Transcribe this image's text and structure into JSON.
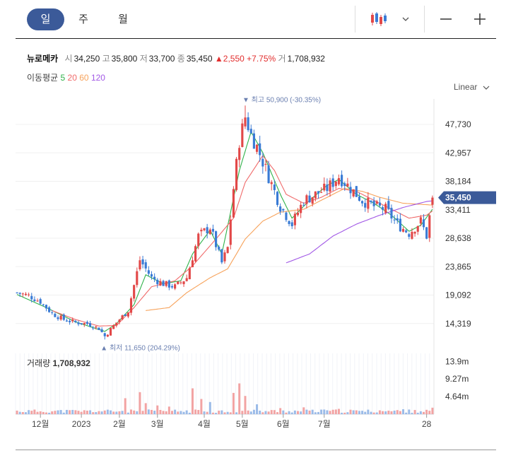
{
  "period_tabs": [
    {
      "label": "일",
      "active": true
    },
    {
      "label": "주",
      "active": false
    },
    {
      "label": "월",
      "active": false
    }
  ],
  "toolbar": {
    "chart_type_icon": "candlestick-icon",
    "dropdown_icon": "chevron-down-icon",
    "zoom_out_icon": "minus-icon",
    "zoom_in_icon": "plus-icon"
  },
  "quote": {
    "name": "뉴로메카",
    "open_label": "시",
    "open": "34,250",
    "high_label": "고",
    "high": "35,800",
    "low_label": "저",
    "low": "33,700",
    "close_label": "종",
    "close": "35,450",
    "change_arrow": "▲",
    "change": "2,550",
    "change_pct": "+7.75%",
    "volume_label": "거",
    "volume": "1,708,932"
  },
  "moving_average": {
    "label": "이동평균",
    "items": [
      {
        "period": "5",
        "color": "#2fb24a"
      },
      {
        "period": "20",
        "color": "#f06a6a"
      },
      {
        "period": "60",
        "color": "#f7a35c"
      },
      {
        "period": "120",
        "color": "#a259e6"
      }
    ]
  },
  "scale_selector": "Linear",
  "colors": {
    "up": "#e24848",
    "down": "#3a7bd5",
    "accent": "#3b5a99"
  },
  "chart_data": {
    "type": "candlestick",
    "price_axis_ticks": [
      "47,730",
      "42,957",
      "38,184",
      "33,411",
      "28,638",
      "23,865",
      "19,092",
      "14,319"
    ],
    "price_axis_values": [
      47730,
      42957,
      38184,
      33411,
      28638,
      23865,
      19092,
      14319
    ],
    "current_price_label": "35,450",
    "current_price": 35450,
    "high_annotation": {
      "marker": "▼",
      "label": "최고",
      "value": "50,900",
      "pct": "(-30.35%)"
    },
    "low_annotation": {
      "marker": "▲",
      "label": "최저",
      "value": "11,650",
      "pct": "(204.29%)"
    },
    "x_axis_labels": [
      "12월",
      "2023",
      "2월",
      "3월",
      "4월",
      "5월",
      "6월",
      "7월",
      "28"
    ],
    "close_path": [
      [
        0,
        19500
      ],
      [
        4,
        19000
      ],
      [
        8,
        18000
      ],
      [
        12,
        16000
      ],
      [
        16,
        15000
      ],
      [
        20,
        14500
      ],
      [
        24,
        14300
      ],
      [
        28,
        13500
      ],
      [
        30,
        12200
      ],
      [
        34,
        14500
      ],
      [
        38,
        16500
      ],
      [
        42,
        25000
      ],
      [
        46,
        22000
      ],
      [
        50,
        21000
      ],
      [
        54,
        20500
      ],
      [
        58,
        22000
      ],
      [
        62,
        29000
      ],
      [
        66,
        30500
      ],
      [
        70,
        24500
      ],
      [
        72,
        27000
      ],
      [
        74,
        37000
      ],
      [
        76,
        45000
      ],
      [
        78,
        49000
      ],
      [
        80,
        46000
      ],
      [
        82,
        44000
      ],
      [
        86,
        39000
      ],
      [
        90,
        34000
      ],
      [
        94,
        31000
      ],
      [
        98,
        35000
      ],
      [
        102,
        36000
      ],
      [
        106,
        37000
      ],
      [
        110,
        39000
      ],
      [
        114,
        37000
      ],
      [
        118,
        35000
      ],
      [
        122,
        34000
      ],
      [
        126,
        33500
      ],
      [
        130,
        31000
      ],
      [
        134,
        29500
      ],
      [
        138,
        31500
      ],
      [
        140,
        29000
      ],
      [
        142,
        35450
      ]
    ],
    "ma_series": [
      {
        "name": "5",
        "points": [
          [
            0,
            19200
          ],
          [
            10,
            17000
          ],
          [
            20,
            14600
          ],
          [
            30,
            13000
          ],
          [
            34,
            14300
          ],
          [
            40,
            17500
          ],
          [
            44,
            22500
          ],
          [
            50,
            21000
          ],
          [
            56,
            21500
          ],
          [
            60,
            26000
          ],
          [
            66,
            30000
          ],
          [
            70,
            26000
          ],
          [
            76,
            40000
          ],
          [
            80,
            46500
          ],
          [
            84,
            43000
          ],
          [
            90,
            36000
          ],
          [
            94,
            32000
          ],
          [
            100,
            35000
          ],
          [
            106,
            37500
          ],
          [
            110,
            38500
          ],
          [
            116,
            36000
          ],
          [
            122,
            34500
          ],
          [
            128,
            32500
          ],
          [
            134,
            29800
          ],
          [
            138,
            30800
          ],
          [
            142,
            33500
          ]
        ]
      },
      {
        "name": "20",
        "points": [
          [
            12,
            16500
          ],
          [
            20,
            15000
          ],
          [
            28,
            13900
          ],
          [
            34,
            14000
          ],
          [
            40,
            17000
          ],
          [
            46,
            20500
          ],
          [
            54,
            21500
          ],
          [
            60,
            24000
          ],
          [
            68,
            28500
          ],
          [
            74,
            32000
          ],
          [
            78,
            38000
          ],
          [
            84,
            42500
          ],
          [
            88,
            40000
          ],
          [
            92,
            36000
          ],
          [
            98,
            34500
          ],
          [
            104,
            35500
          ],
          [
            110,
            37000
          ],
          [
            116,
            36500
          ],
          [
            122,
            35000
          ],
          [
            128,
            33500
          ],
          [
            134,
            32000
          ],
          [
            140,
            32500
          ],
          [
            142,
            33200
          ]
        ]
      },
      {
        "name": "60",
        "points": [
          [
            44,
            16500
          ],
          [
            52,
            17000
          ],
          [
            58,
            19500
          ],
          [
            66,
            22000
          ],
          [
            72,
            23500
          ],
          [
            78,
            28500
          ],
          [
            84,
            31500
          ],
          [
            90,
            33000
          ],
          [
            98,
            33500
          ],
          [
            106,
            35500
          ],
          [
            112,
            37000
          ],
          [
            118,
            36500
          ],
          [
            124,
            35500
          ],
          [
            132,
            34500
          ],
          [
            142,
            34200
          ]
        ]
      },
      {
        "name": "120",
        "points": [
          [
            92,
            24500
          ],
          [
            100,
            26000
          ],
          [
            108,
            29000
          ],
          [
            116,
            31000
          ],
          [
            124,
            32500
          ],
          [
            132,
            33800
          ],
          [
            140,
            34800
          ],
          [
            142,
            34900
          ]
        ]
      }
    ],
    "volume": {
      "label": "거래량",
      "value": "1,708,932",
      "axis_ticks": [
        "13.9m",
        "9.27m",
        "4.64m"
      ],
      "axis_values": [
        13.9,
        9.27,
        4.64
      ],
      "spikes": [
        [
          37,
          4.2,
          "up"
        ],
        [
          42,
          5.8,
          "up"
        ],
        [
          44,
          2.9,
          "up"
        ],
        [
          48,
          2.3,
          "up"
        ],
        [
          52,
          2.0,
          "up"
        ],
        [
          60,
          6.8,
          "up"
        ],
        [
          63,
          4.0,
          "up"
        ],
        [
          66,
          3.2,
          "down"
        ],
        [
          74,
          5.6,
          "up"
        ],
        [
          76,
          8.1,
          "up"
        ],
        [
          78,
          4.8,
          "up"
        ],
        [
          82,
          2.6,
          "down"
        ],
        [
          90,
          1.6,
          "up"
        ],
        [
          98,
          1.8,
          "up"
        ],
        [
          104,
          1.2,
          "down"
        ],
        [
          110,
          1.4,
          "up"
        ],
        [
          118,
          0.9,
          "down"
        ],
        [
          124,
          1.0,
          "up"
        ],
        [
          132,
          1.3,
          "down"
        ],
        [
          136,
          1.1,
          "up"
        ],
        [
          142,
          1.71,
          "up"
        ]
      ]
    }
  }
}
